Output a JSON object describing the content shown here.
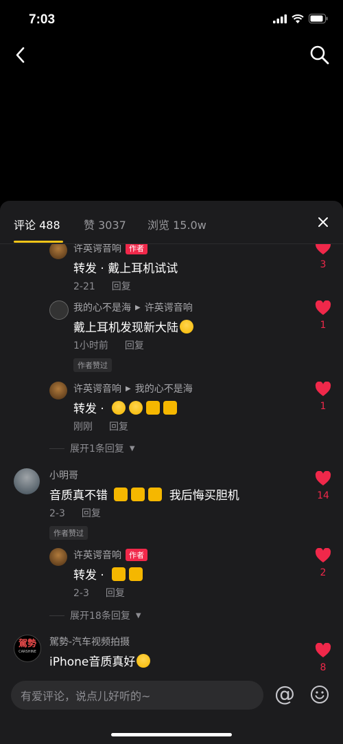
{
  "status": {
    "time": "7:03"
  },
  "tabs": {
    "comments": "评论 488",
    "likes": "赞 3037",
    "views": "浏览 15.0w"
  },
  "comments": [
    {
      "name": "许英谔音响",
      "badge": "作者",
      "text": "转发 · 戴上耳机试试",
      "time": "2-21",
      "reply": "回复",
      "likes": "3"
    },
    {
      "name": "我的心不是海",
      "target": "许英谔音响",
      "text": "戴上耳机发现新大陆",
      "time": "1小时前",
      "reply": "回复",
      "liked_by_author": "作者赞过",
      "likes": "1"
    },
    {
      "name": "许英谔音响",
      "target": "我的心不是海",
      "text": "转发 ·",
      "time": "刚刚",
      "reply": "回复",
      "likes": "1"
    },
    {
      "expand": "展开1条回复"
    },
    {
      "name": "小明哥",
      "text_a": "音质真不错",
      "text_b": "我后悔买胆机",
      "time": "2-3",
      "reply": "回复",
      "liked_by_author": "作者赞过",
      "likes": "14"
    },
    {
      "name": "许英谔音响",
      "badge": "作者",
      "text": "转发 ·",
      "time": "2-3",
      "reply": "回复",
      "likes": "2"
    },
    {
      "expand": "展开18条回复"
    },
    {
      "name": "駕勢-汽车视频拍摄",
      "avatar_text": "駕勢",
      "avatar_sub": "CARSHINE",
      "text": "iPhone音质真好",
      "likes": "8"
    }
  ],
  "input": {
    "placeholder": "有爱评论，说点儿好听的~"
  },
  "icons": {
    "at": "@"
  },
  "colors": {
    "accent": "#f5c518",
    "like": "#f0284a",
    "panel": "#1c1c1e"
  }
}
